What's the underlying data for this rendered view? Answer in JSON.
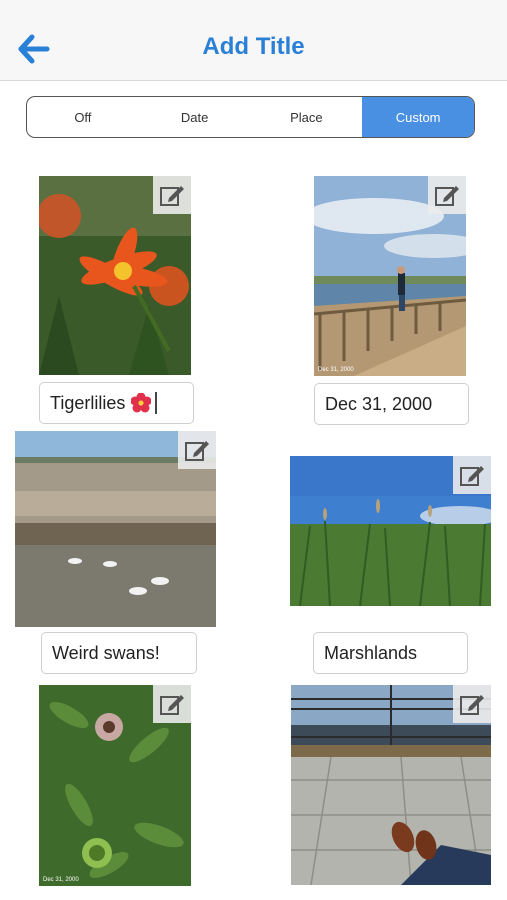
{
  "header": {
    "title": "Add Title"
  },
  "title_modes": {
    "options": [
      "Off",
      "Date",
      "Place",
      "Custom"
    ],
    "selected": "Custom"
  },
  "colors": {
    "accent": "#4a90e2",
    "title": "#2a7fd6"
  },
  "photos": [
    {
      "caption": "Tigerlilies",
      "caption_emoji": "hibiscus-flower",
      "date_stamp": ""
    },
    {
      "caption": "Dec 31, 2000",
      "date_stamp": "Dec 31, 2000"
    },
    {
      "caption": "Weird swans!",
      "date_stamp": ""
    },
    {
      "caption": "Marshlands",
      "date_stamp": ""
    },
    {
      "caption": "",
      "date_stamp": "Dec 31, 2000"
    },
    {
      "caption": "",
      "date_stamp": ""
    }
  ]
}
